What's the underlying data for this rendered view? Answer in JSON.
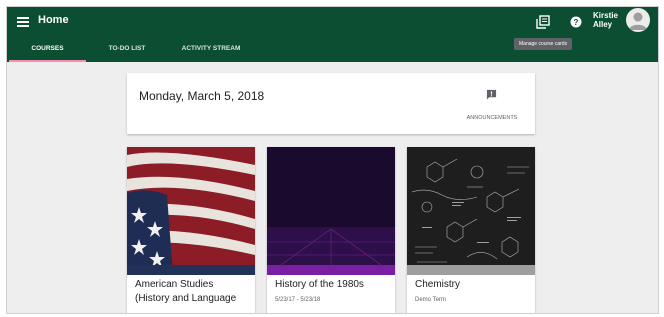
{
  "header": {
    "title": "Home",
    "user_name_line1": "Kirstie",
    "user_name_line2": "Alley",
    "tooltip": "Manage course cards"
  },
  "tabs": [
    {
      "label": "COURSES",
      "active": true
    },
    {
      "label": "TO-DO LIST",
      "active": false
    },
    {
      "label": "ACTIVITY STREAM",
      "active": false
    }
  ],
  "date_card": {
    "date": "Monday, March 5, 2018",
    "announcements_label": "ANNOUNCEMENTS"
  },
  "courses": [
    {
      "name": "American Studies (History and Language",
      "term": "",
      "image": "american-flag",
      "color": "#213157"
    },
    {
      "name": "History of the 1980s",
      "term": "5/23/17 - 5/23/18",
      "image": "back-to-the-80s",
      "color": "#7b1fa2"
    },
    {
      "name": "Chemistry",
      "term": "Demo Term",
      "image": "chalkboard-formulas",
      "color": "#9e9e9e"
    }
  ],
  "colors": {
    "appbar": "#0c4e32",
    "tab_indicator": "#f48fb1",
    "background": "#eeeeee"
  }
}
